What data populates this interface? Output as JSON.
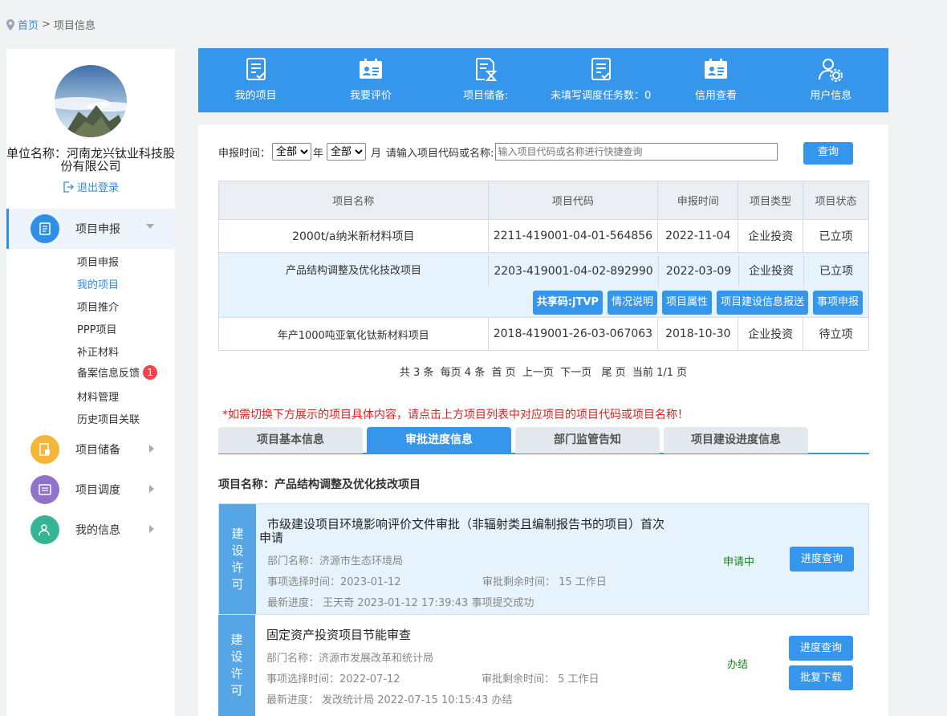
{
  "breadcrumb": {
    "home": "首页",
    "sep": ">",
    "current": "项目信息"
  },
  "sidebar": {
    "unit_name": "单位名称：河南龙兴钛业科技股份有限公司",
    "logout": "退出登录",
    "menus": [
      {
        "label": "项目申报",
        "color": "#2f8ee6"
      },
      {
        "label": "项目储备",
        "color": "#f5b63a"
      },
      {
        "label": "项目调度",
        "color": "#8e73c9"
      },
      {
        "label": "我的信息",
        "color": "#35b595"
      }
    ],
    "subitems": [
      "项目申报",
      "我的项目",
      "项目推介",
      "PPP项目",
      "补正材料",
      "备案信息反馈",
      "材料管理",
      "历史项目关联"
    ],
    "badge": "1"
  },
  "topbar": [
    {
      "label": "我的项目",
      "icon": "list-check-icon"
    },
    {
      "label": "我要评价",
      "icon": "calendar-card-icon"
    },
    {
      "label": "项目储备:",
      "icon": "doc-hourglass-icon"
    },
    {
      "label": "未填写调度任务数：0",
      "icon": "list-check-icon"
    },
    {
      "label": "信用查看",
      "icon": "calendar-card-icon"
    },
    {
      "label": "用户信息",
      "icon": "user-gear-icon"
    }
  ],
  "filter": {
    "time_label": "申报时间：",
    "year_option": "全部",
    "year_unit": "年",
    "month_option": "全部",
    "month_unit": "月",
    "search_label": "请输入项目代码或名称:",
    "placeholder": "输入项目代码或名称进行快捷查询",
    "query": "查询"
  },
  "table": {
    "headers": [
      "项目名称",
      "项目代码",
      "申报时间",
      "项目类型",
      "项目状态"
    ],
    "rows": [
      [
        "2000t/a纳米新材料项目",
        "2211-419001-04-01-564856",
        "2022-11-04",
        "企业投资",
        "已立项"
      ],
      [
        "产品结构调整及优化技改项目",
        "2203-419001-04-02-892990",
        "2022-03-09",
        "企业投资",
        "已立项"
      ],
      [
        "年产1000吨亚氧化钛新材料项目",
        "2018-419001-26-03-067063",
        "2018-10-30",
        "企业投资",
        "待立项"
      ]
    ],
    "actions": [
      "共享码:jTVP",
      "情况说明",
      "项目属性",
      "项目建设信息报送",
      "事项申报"
    ]
  },
  "pager": "共 3 条  每页 4 条  首 页  上一页  下一页   尾 页  当前 1/1 页",
  "notice": "*如需切换下方展示的项目具体内容，请点击上方项目列表中对应项目的项目代码或项目名称！",
  "tabs": [
    "项目基本信息",
    "审批进度信息",
    "部门监管告知",
    "项目建设进度信息"
  ],
  "project_name": "项目名称：产品结构调整及优化技改项目",
  "items": [
    {
      "tag": [
        "建",
        "设",
        "许",
        "可"
      ],
      "title_l1": "市级建设项目环境影响评价文件审批（非辐射类且编制报告书的项目）首次",
      "title_l2": "申请",
      "dept": "部门名称：济源市生态环境局",
      "select_time": "事项选择时间：2023-01-12",
      "remain": "审批剩余时间：  15 工作日",
      "progress": "最新进度：  王天奇 2023-01-12 17:39:43  事项提交成功",
      "status": "申请中",
      "btn1": "进度查询"
    },
    {
      "tag": [
        "建",
        "设",
        "许",
        "可"
      ],
      "title_l1": "固定资产投资项目节能审查",
      "dept": "部门名称：济源市发展改革和统计局",
      "select_time": "事项选择时间：2022-07-12",
      "remain": "审批剩余时间：  5 工作日",
      "progress": "最新进度：  发改统计局 2022-07-15 10:15:43 办结",
      "status": "办结",
      "btn1": "进度查询",
      "btn2": "批复下载"
    }
  ]
}
